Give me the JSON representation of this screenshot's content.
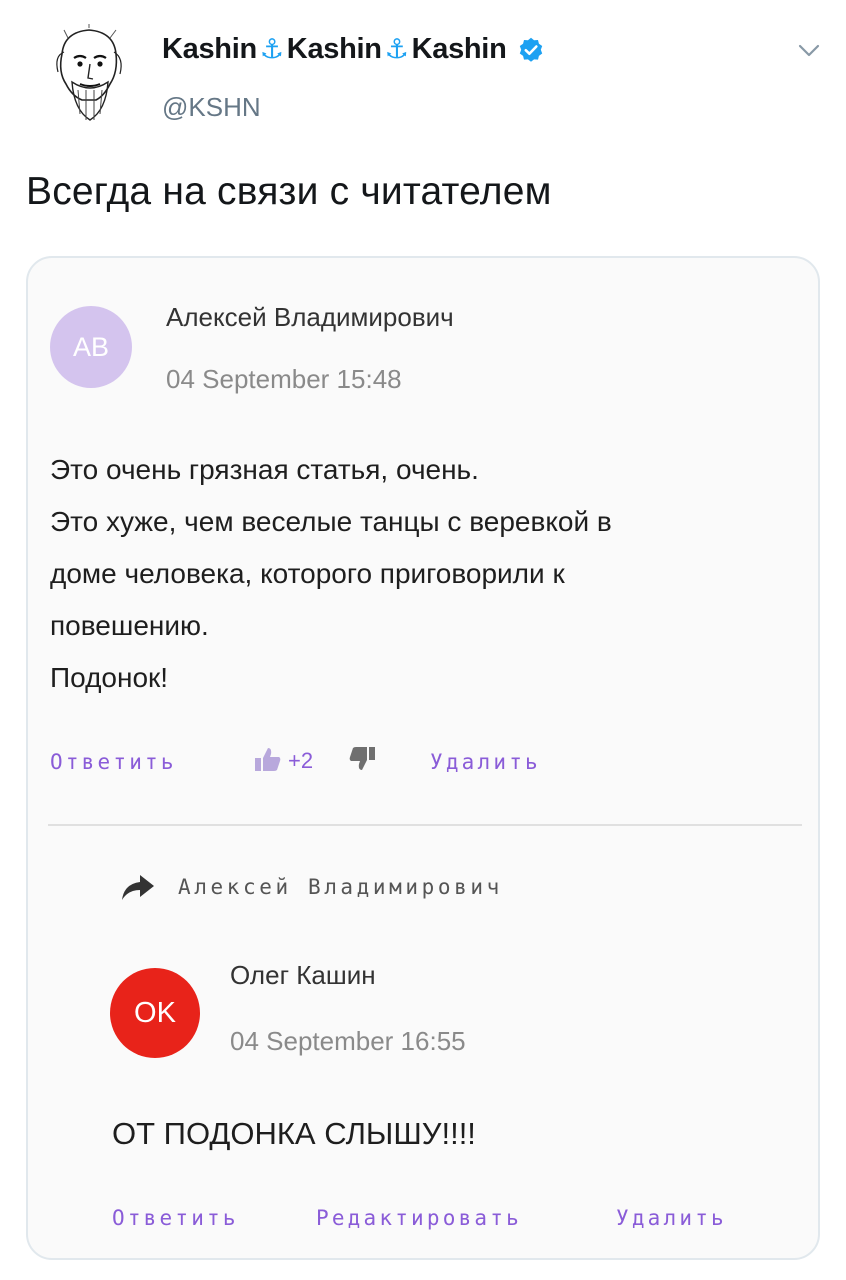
{
  "tweet": {
    "display_name_parts": [
      "Kashin",
      "Kashin",
      "Kashin"
    ],
    "anchor_glyph": "⚓",
    "handle": "@KSHN",
    "text": "Всегда на связи с читателем",
    "icons": {
      "verified": "verified-badge-icon",
      "chevron": "chevron-down-icon"
    },
    "colors": {
      "verified": "#1da1f2",
      "handle": "#657786"
    }
  },
  "comment": {
    "avatar_initials": "АВ",
    "avatar_color": "#d4c4ee",
    "author": "Алексей Владимирович",
    "date": "04 September 15:48",
    "body_lines": [
      "Это очень грязная статья, очень.",
      "Это хуже, чем веселые танцы с веревкой в",
      "доме человека, которого приговорили к",
      "повешению.",
      "Подонок!"
    ],
    "actions": {
      "reply": "Ответить",
      "score": "+2",
      "delete": "Удалить"
    }
  },
  "reply": {
    "reply_to": "Алексей Владимирович",
    "avatar_initials": "OK",
    "avatar_color": "#e8231a",
    "author": "Олег Кашин",
    "date": "04 September 16:55",
    "body": "ОТ ПОДОНКА СЛЫШУ!!!!",
    "actions": {
      "reply": "Ответить",
      "edit": "Редактировать",
      "delete": "Удалить"
    }
  },
  "accent_color": "#8a5cd8"
}
